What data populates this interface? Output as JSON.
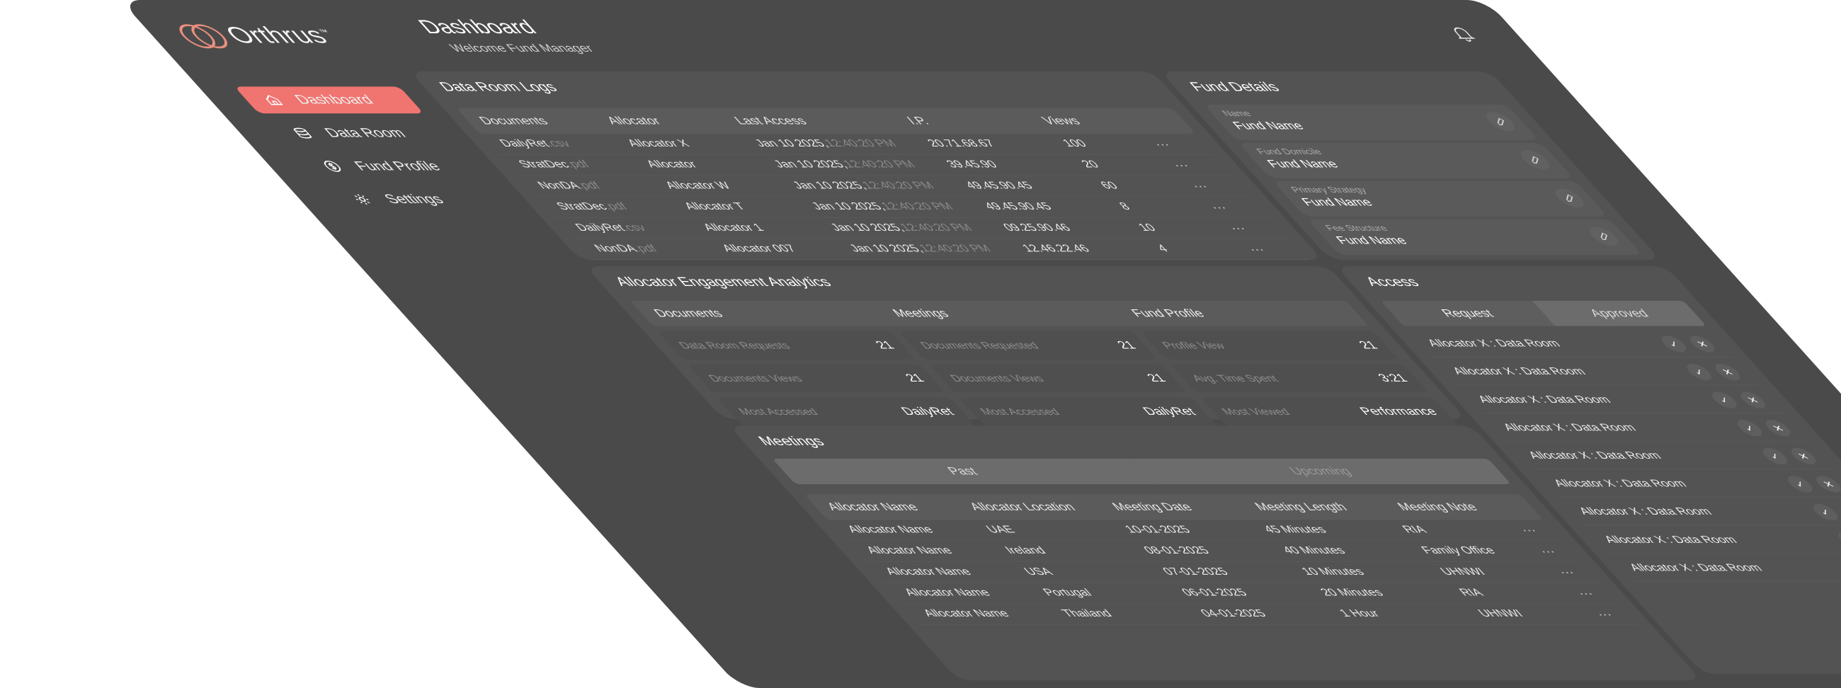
{
  "brand": {
    "name": "Orthrus",
    "tm": "™"
  },
  "header": {
    "title": "Dashboard",
    "subtitle": "Welcome Fund Manager"
  },
  "nav": [
    {
      "label": "Dashboard",
      "icon": "home-icon",
      "active": true
    },
    {
      "label": "Data Room",
      "icon": "database-icon",
      "active": false
    },
    {
      "label": "Fund Profile",
      "icon": "dollar-circle-icon",
      "active": false
    },
    {
      "label": "Settings",
      "icon": "gear-icon",
      "active": false
    }
  ],
  "data_room": {
    "title": "Data Room Logs",
    "columns": [
      "Documents",
      "Allocator",
      "Last Access",
      "I.P.",
      "Views"
    ],
    "rows": [
      {
        "name": "DailyRet",
        "ext": ".csv",
        "allocator": "Allocator X",
        "date": "Jan 10 2025,",
        "time": "12:40:20 PM",
        "ip": "20.71.68.67",
        "views": "100"
      },
      {
        "name": "StratDec",
        "ext": ".pdf",
        "allocator": "Allocator",
        "date": "Jan 10 2025,",
        "time": "12:40:20 PM",
        "ip": "39.45.90",
        "views": "20"
      },
      {
        "name": "NonDA",
        "ext": ".pdf",
        "allocator": "Allocator W",
        "date": "Jan 10 2025,",
        "time": "12:40:20 PM",
        "ip": "49.45.90.45",
        "views": "60"
      },
      {
        "name": "StratDec",
        "ext": ".pdf",
        "allocator": "Allocator T",
        "date": "Jan 10 2025,",
        "time": "12:40:20 PM",
        "ip": "49.45.90.45",
        "views": "8"
      },
      {
        "name": "DailyRet",
        "ext": ".csv",
        "allocator": "Allocator 1",
        "date": "Jan 10 2025,",
        "time": "12:40:20 PM",
        "ip": "09.25.90.46",
        "views": "10"
      },
      {
        "name": "NonDA",
        "ext": ".pdf",
        "allocator": "Allocator 007",
        "date": "Jan 10 2025,",
        "time": "12:40:20 PM",
        "ip": "12.46.22.46",
        "views": "4"
      }
    ],
    "more": "···"
  },
  "fund_details": {
    "title": "Fund Details",
    "fields": [
      {
        "label": "Name",
        "value": "Fund Name"
      },
      {
        "label": "Fund Domicile",
        "value": "Fund Name"
      },
      {
        "label": "Primary Strategy",
        "value": "Fund Name"
      },
      {
        "label": "Fee Structure",
        "value": "Fund Name"
      }
    ]
  },
  "engagement": {
    "title": "Allocator Engagement Analytics",
    "columns": [
      "Documents",
      "Meetings",
      "Fund Profile"
    ],
    "col_rows": [
      [
        {
          "label": "Data Room Requests",
          "value": "21"
        },
        {
          "label": "Documents Views",
          "value": "21"
        },
        {
          "label": "Most Accessed",
          "value": "DailyRet"
        }
      ],
      [
        {
          "label": "Documents Requested",
          "value": "21"
        },
        {
          "label": "Documents Views",
          "value": "21"
        },
        {
          "label": "Most Accessed",
          "value": "DailyRet"
        }
      ],
      [
        {
          "label": "Profile View",
          "value": "21"
        },
        {
          "label": "Avg. Time Spent",
          "value": "3:21"
        },
        {
          "label": "Most Viewed",
          "value": "Performance"
        }
      ]
    ]
  },
  "access": {
    "title": "Access",
    "tabs": [
      "Request",
      "Approved"
    ],
    "row_label": "Allocator X : Data Room",
    "rows": 9,
    "approve": "✓",
    "reject": "✕"
  },
  "meetings": {
    "title": "Meetings",
    "tabs": [
      "Past",
      "Upcoming"
    ],
    "columns": [
      "Allocator Name",
      "Allocator Location",
      "Meeting Date",
      "Meeting Length",
      "Meeting Note"
    ],
    "rows": [
      {
        "name": "Allocator Name",
        "loc": "UAE",
        "date": "10-01-2025",
        "len": "45 Minutes",
        "note": "RIA"
      },
      {
        "name": "Allocator Name",
        "loc": "Ireland",
        "date": "08-01-2025",
        "len": "40 Minutes",
        "note": "Family Office"
      },
      {
        "name": "Allocator Name",
        "loc": "USA",
        "date": "07-01-2025",
        "len": "10 Minutes",
        "note": "UHNWI"
      },
      {
        "name": "Allocator Name",
        "loc": "Portugal",
        "date": "06-01-2025",
        "len": "20 Minutes",
        "note": "RIA"
      },
      {
        "name": "Allocator Name",
        "loc": "Thailand",
        "date": "04-01-2025",
        "len": "1 Hour",
        "note": "UHNWI"
      }
    ],
    "more": "···"
  }
}
